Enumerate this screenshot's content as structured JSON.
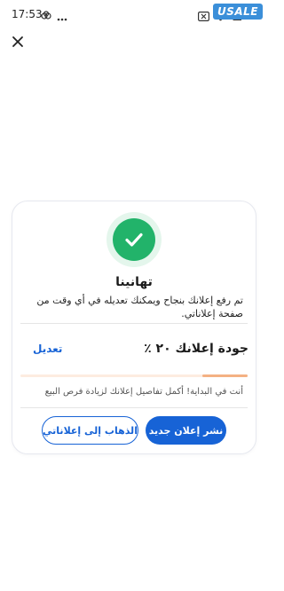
{
  "status_bar": {
    "time": "17:53",
    "icons_left": [
      "notification-icon",
      "more-dots-icon"
    ],
    "icons_right": [
      "battery-saver-icon",
      "wifi-icon",
      "signal-icon"
    ]
  },
  "watermark": "USALE",
  "header": {
    "close_icon": "close-icon"
  },
  "success_card": {
    "icon": "check-circle-icon",
    "accent_color": "#22b36a",
    "title": "تهانينا",
    "message": "تم رفع إعلانك بنجاح ويمكنك تعديله في أي وقت من صفحة إعلاناتي.",
    "quality_label": "جودة إعلانك ٢٠ ٪",
    "quality_percent": 20,
    "edit_label": "تعديل",
    "hint": "أنت في البداية! أكمل تفاصيل إعلانك لزيادة فرص البيع",
    "primary_button": "نشر إعلان جديد",
    "secondary_button": "الذهاب إلى إعلاناتي",
    "button_color": "#1763d6"
  }
}
